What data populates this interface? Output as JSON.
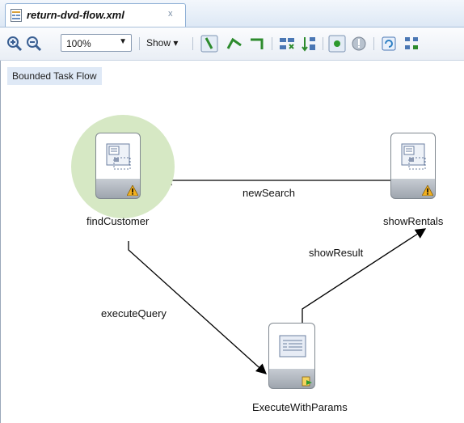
{
  "editor_tab": {
    "title": "return-dvd-flow.xml",
    "close_glyph": "x",
    "icon": "xml-file-icon"
  },
  "toolbar": {
    "zoom_value": "100%",
    "show_label": "Show",
    "show_arrow": "▾",
    "icons": [
      "zoom-in-icon",
      "zoom-out-icon",
      "control-flow-case-icon",
      "wildcard-flow-icon",
      "router-icon",
      "align-icon",
      "layout-icon",
      "breakpoint-icon",
      "warning-icon",
      "refresh-icon",
      "overview-icon"
    ]
  },
  "canvas": {
    "flow_type_label": "Bounded Task Flow",
    "nodes": [
      {
        "label": "findCustomer",
        "type": "view",
        "badge": "warning",
        "default_activity": true
      },
      {
        "label": "showRentals",
        "type": "view",
        "badge": "warning"
      },
      {
        "label": "ExecuteWithParams",
        "type": "method-call",
        "badge": "method"
      }
    ],
    "edges": [
      {
        "label": "newSearch",
        "from": "showRentals",
        "to": "findCustomer"
      },
      {
        "label": "executeQuery",
        "from": "findCustomer",
        "to": "ExecuteWithParams"
      },
      {
        "label": "showResult",
        "from": "ExecuteWithParams",
        "to": "showRentals"
      }
    ]
  },
  "colors": {
    "default_activity_halo": "#d6e8c4",
    "flow_label_bg": "#dfe9f6",
    "warning": "#f2b01e"
  }
}
